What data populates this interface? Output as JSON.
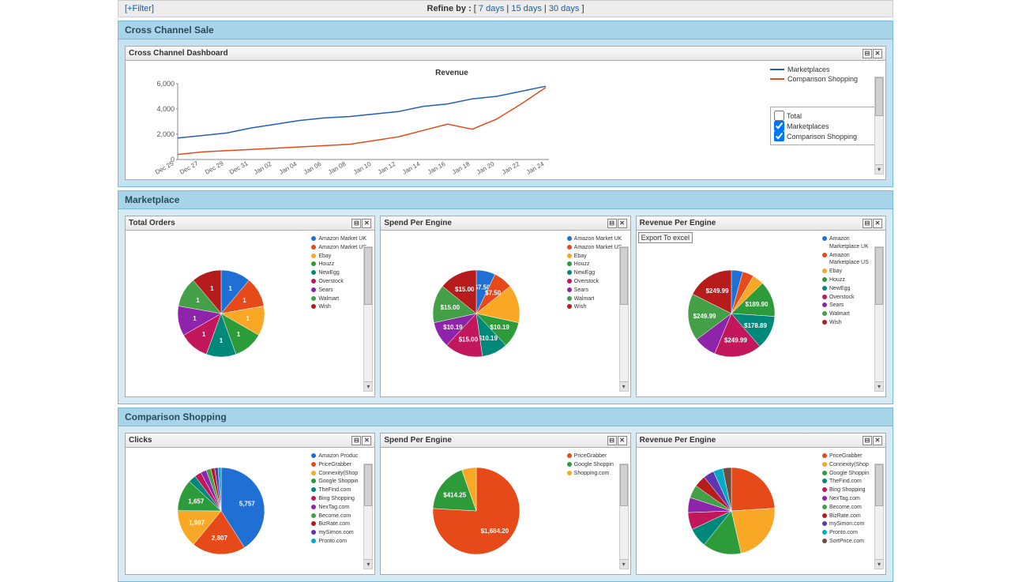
{
  "filter_bar": {
    "filter_link": "[+Filter]",
    "refine_label": "Refine by :",
    "bracket_open": "[ ",
    "bracket_close": "]",
    "sep": "| ",
    "opts": [
      "7 days",
      "15 days",
      "30 days"
    ]
  },
  "sections": {
    "cross_channel": {
      "title": "Cross Channel Sale"
    },
    "marketplace": {
      "title": "Marketplace"
    },
    "comparison": {
      "title": "Comparison Shopping"
    }
  },
  "widgets": {
    "cross_dash": {
      "title": "Cross Channel Dashboard",
      "chart_title": "Revenue"
    },
    "mp_orders": {
      "title": "Total Orders"
    },
    "mp_spend": {
      "title": "Spend Per Engine"
    },
    "mp_revenue": {
      "title": "Revenue Per Engine",
      "export": "Export To excel"
    },
    "cs_clicks": {
      "title": "Clicks"
    },
    "cs_spend": {
      "title": "Spend Per Engine"
    },
    "cs_revenue": {
      "title": "Revenue Per Engine"
    }
  },
  "icons": {
    "minimize": "⊟",
    "close": "✕",
    "darr": "▾"
  },
  "line_legend": {
    "series": [
      {
        "label": "Marketplaces",
        "color": "#1f5fbf"
      },
      {
        "label": "Comparison Shopping",
        "color": "#e64a19"
      }
    ],
    "checkboxes": [
      {
        "label": "Total",
        "checked": false
      },
      {
        "label": "Marketplaces",
        "checked": true
      },
      {
        "label": "Comparison Shopping",
        "checked": true
      }
    ]
  },
  "chart_data": [
    {
      "id": "cross_channel_revenue",
      "type": "line",
      "title": "Revenue",
      "xlabel": "",
      "ylabel": "",
      "ylim": [
        0,
        6000
      ],
      "y_ticks": [
        0,
        2000,
        4000,
        6000
      ],
      "categories": [
        "Dec 25",
        "Dec 27",
        "Dec 29",
        "Dec 31",
        "Jan 02",
        "Jan 04",
        "Jan 06",
        "Jan 08",
        "Jan 10",
        "Jan 12",
        "Jan 14",
        "Jan 16",
        "Jan 18",
        "Jan 20",
        "Jan 22",
        "Jan 24"
      ],
      "series": [
        {
          "name": "Marketplaces",
          "color": "#1f5fbf",
          "values": [
            1700,
            1900,
            2100,
            2500,
            2800,
            3100,
            3300,
            3400,
            3600,
            3800,
            4200,
            4400,
            4800,
            5000,
            5400,
            5800
          ]
        },
        {
          "name": "Comparison Shopping",
          "color": "#e64a19",
          "values": [
            400,
            600,
            700,
            800,
            900,
            1000,
            1100,
            1200,
            1500,
            1800,
            2300,
            2800,
            2400,
            3200,
            4400,
            5700
          ]
        }
      ]
    },
    {
      "id": "mp_total_orders",
      "type": "pie",
      "series": [
        {
          "name": "Amazon Market UK",
          "value": 1,
          "color": "#1f6fd4"
        },
        {
          "name": "Amazon Market US",
          "value": 1,
          "color": "#e64a19"
        },
        {
          "name": "Ebay",
          "value": 1,
          "color": "#f9a825"
        },
        {
          "name": "Houzz",
          "value": 1,
          "color": "#2e9b3a"
        },
        {
          "name": "NewEgg",
          "value": 1,
          "color": "#00897b"
        },
        {
          "name": "Overstock",
          "value": 1,
          "color": "#c2185b"
        },
        {
          "name": "Sears",
          "value": 1,
          "color": "#8e24aa"
        },
        {
          "name": "Walmart",
          "value": 1,
          "color": "#43a047"
        },
        {
          "name": "Wish",
          "value": 1,
          "color": "#b71c1c"
        }
      ],
      "labels": [
        "1",
        "1",
        "1",
        "1",
        "1",
        "1",
        "1",
        "1",
        "1"
      ]
    },
    {
      "id": "mp_spend_per_engine",
      "type": "pie",
      "series": [
        {
          "name": "Amazon Market UK",
          "value": 7.5,
          "color": "#1f6fd4"
        },
        {
          "name": "Amazon Market US",
          "value": 7.5,
          "color": "#e64a19"
        },
        {
          "name": "Ebay",
          "value": 15.0,
          "color": "#f9a825"
        },
        {
          "name": "Houzz",
          "value": 10.19,
          "color": "#2e9b3a"
        },
        {
          "name": "NewEgg",
          "value": 10.19,
          "color": "#00897b"
        },
        {
          "name": "Overstock",
          "value": 15.0,
          "color": "#c2185b"
        },
        {
          "name": "Sears",
          "value": 10.19,
          "color": "#8e24aa"
        },
        {
          "name": "Walmart",
          "value": 15.0,
          "color": "#43a047"
        },
        {
          "name": "Wish",
          "value": 15.0,
          "color": "#b71c1c"
        }
      ],
      "labels": [
        "$7.50",
        "$7.50",
        "",
        "$10.19",
        "$10.19",
        "$15.00",
        "$10.19",
        "$15.00",
        "$15.00"
      ]
    },
    {
      "id": "mp_revenue_per_engine",
      "type": "pie",
      "series": [
        {
          "name": "Amazon Marketplace UK",
          "value": 60,
          "color": "#1f6fd4"
        },
        {
          "name": "Amazon Marketplace US",
          "value": 60,
          "color": "#e64a19"
        },
        {
          "name": "Ebay",
          "value": 60,
          "color": "#f9a825"
        },
        {
          "name": "Houzz",
          "value": 189.9,
          "color": "#2e9b3a"
        },
        {
          "name": "NewEgg",
          "value": 178.89,
          "color": "#00897b"
        },
        {
          "name": "Overstock",
          "value": 249.99,
          "color": "#c2185b"
        },
        {
          "name": "Sears",
          "value": 120,
          "color": "#8e24aa"
        },
        {
          "name": "Walmart",
          "value": 249.99,
          "color": "#43a047"
        },
        {
          "name": "Wish",
          "value": 249.99,
          "color": "#b71c1c"
        }
      ],
      "labels": [
        "",
        "",
        "",
        "$189.90",
        "$178.89",
        "$249.99",
        "",
        "$249.99",
        "$249.99"
      ]
    },
    {
      "id": "cs_clicks",
      "type": "pie",
      "series": [
        {
          "name": "Amazon Produc",
          "value": 5757,
          "color": "#1f6fd4"
        },
        {
          "name": "PriceGrabber",
          "value": 2807,
          "color": "#e64a19"
        },
        {
          "name": "Connexity(Shop",
          "value": 1987,
          "color": "#f9a825"
        },
        {
          "name": "Google Shoppin",
          "value": 1657,
          "color": "#2e9b3a"
        },
        {
          "name": "TheFind.com",
          "value": 400,
          "color": "#00897b"
        },
        {
          "name": "Bing Shopping",
          "value": 350,
          "color": "#c2185b"
        },
        {
          "name": "NexTag.com",
          "value": 300,
          "color": "#8e24aa"
        },
        {
          "name": "Become.com",
          "value": 250,
          "color": "#43a047"
        },
        {
          "name": "BizRate.com",
          "value": 200,
          "color": "#b71c1c"
        },
        {
          "name": "mySimon.com",
          "value": 180,
          "color": "#5e35b1"
        },
        {
          "name": "Pronto.com",
          "value": 160,
          "color": "#00acc1"
        }
      ],
      "labels": [
        "5,757",
        "2,807",
        "1,987",
        "1,657",
        "",
        "",
        "",
        "",
        "",
        "",
        ""
      ]
    },
    {
      "id": "cs_spend_per_engine",
      "type": "pie",
      "series": [
        {
          "name": "PriceGrabber",
          "value": 1684.2,
          "color": "#e64a19"
        },
        {
          "name": "Google Shoppin",
          "value": 414.25,
          "color": "#2e9b3a"
        },
        {
          "name": "Shopping.com",
          "value": 120,
          "color": "#f9a825"
        }
      ],
      "labels": [
        "$1,684.20",
        "$414.25",
        ""
      ]
    },
    {
      "id": "cs_revenue_per_engine",
      "type": "pie",
      "series": [
        {
          "name": "PriceGrabber",
          "value": 300,
          "color": "#e64a19"
        },
        {
          "name": "Connexity(Shop",
          "value": 280,
          "color": "#f9a825"
        },
        {
          "name": "Google Shoppin",
          "value": 180,
          "color": "#2e9b3a"
        },
        {
          "name": "TheFind.com",
          "value": 90,
          "color": "#00897b"
        },
        {
          "name": "Bing Shopping",
          "value": 80,
          "color": "#c2185b"
        },
        {
          "name": "NexTag.com",
          "value": 70,
          "color": "#8e24aa"
        },
        {
          "name": "Become.com",
          "value": 60,
          "color": "#43a047"
        },
        {
          "name": "BizRate.com",
          "value": 55,
          "color": "#b71c1c"
        },
        {
          "name": "mySimon.com",
          "value": 50,
          "color": "#5e35b1"
        },
        {
          "name": "Pronto.com",
          "value": 45,
          "color": "#00acc1"
        },
        {
          "name": "SortPrice.com",
          "value": 40,
          "color": "#6d4c41"
        }
      ],
      "labels": [
        "",
        "",
        "",
        "",
        "",
        "",
        "",
        "",
        "",
        "",
        ""
      ]
    }
  ]
}
